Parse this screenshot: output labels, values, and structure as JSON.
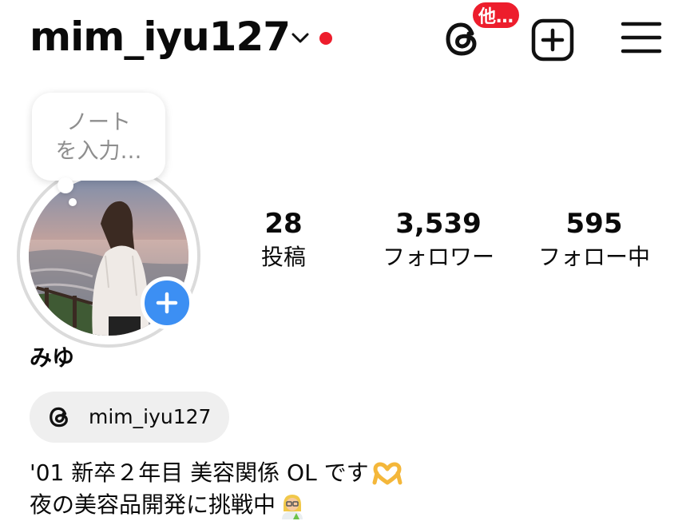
{
  "header": {
    "username": "mim_iyu127",
    "more_badge": "他…"
  },
  "note": {
    "placeholder_line1": "ノート",
    "placeholder_line2": "を入力…"
  },
  "stats": [
    {
      "value": "28",
      "label": "投稿"
    },
    {
      "value": "3,539",
      "label": "フォロワー"
    },
    {
      "value": "595",
      "label": "フォロー中"
    }
  ],
  "profile": {
    "display_name": "みゆ",
    "threads_handle": "mim_iyu127",
    "bio_line1": "'01 新卒２年目 美容関係 OL です",
    "bio_line2": "夜の美容品開発に挑戦中"
  },
  "icons": {
    "username_dropdown": "chevron-down-icon",
    "notification_dot": "red-dot-icon",
    "threads": "threads-icon",
    "create": "plus-square-icon",
    "menu": "hamburger-menu-icon",
    "avatar_add": "plus-icon",
    "bio_emoji_1": "heart-hands-emoji",
    "bio_emoji_2": "scientist-emoji"
  },
  "colors": {
    "notification_red": "#ed1d2c",
    "add_blue": "#3c8ff3",
    "chip_bg": "#efefef",
    "muted_text": "#8e8e8e"
  }
}
